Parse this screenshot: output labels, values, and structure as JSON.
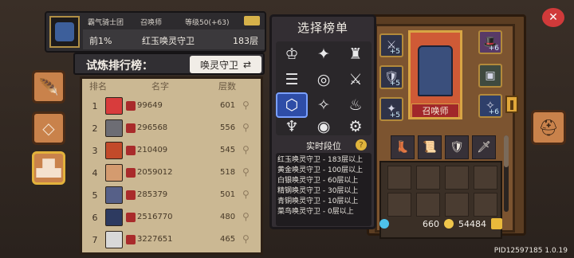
{
  "header": {
    "guild": "霸气骑士团",
    "class_name": "召唤师",
    "level": "等级50(+63)",
    "percent": "前1%",
    "rank_title": "红玉唤灵守卫",
    "floors": "183层"
  },
  "ranking": {
    "title": "试炼排行榜：",
    "dropdown_label": "唤灵守卫",
    "dropdown_icon": "swap-icon",
    "columns": [
      "排名",
      "名字",
      "层数"
    ],
    "rows": [
      {
        "rank": "1",
        "name": "99649",
        "floors": "601",
        "avatar_color": "#d83c3c"
      },
      {
        "rank": "2",
        "name": "296568",
        "floors": "556",
        "avatar_color": "#6d6d74"
      },
      {
        "rank": "3",
        "name": "210409",
        "floors": "545",
        "avatar_color": "#c24a2a"
      },
      {
        "rank": "4",
        "name": "2059012",
        "floors": "518",
        "avatar_color": "#d49b6f"
      },
      {
        "rank": "5",
        "name": "285379",
        "floors": "501",
        "avatar_color": "#566088"
      },
      {
        "rank": "6",
        "name": "2516770",
        "floors": "480",
        "avatar_color": "#2d3a60"
      },
      {
        "rank": "7",
        "name": "3227651",
        "floors": "465",
        "avatar_color": "#d8d8d8"
      }
    ]
  },
  "selection": {
    "title": "选择榜单",
    "icons": [
      "crest-icon",
      "star-blade-icon",
      "castle-icon",
      "pillar-icon",
      "swirl-icon",
      "crossed-axes-icon",
      "hex-emblem-icon",
      "compass-star-icon",
      "flame-icon",
      "horns-icon",
      "vortex-icon",
      "gear-icon"
    ],
    "selected_index": 6
  },
  "realtime": {
    "title": "实时段位",
    "coin_icon": "?",
    "tiers": [
      "红玉唤灵守卫 - 183层以上",
      "黄金唤灵守卫 - 100层以上",
      "白银唤灵守卫 - 60层以上",
      "精钢唤灵守卫 - 30层以上",
      "青铜唤灵守卫 - 10层以上",
      "菜鸟唤灵守卫 - 0层以上"
    ]
  },
  "hero": {
    "label": "召唤师",
    "slots_plus": [
      "+5",
      "+6",
      "+5",
      "+5",
      "+6"
    ]
  },
  "resources": {
    "gems": "660",
    "coins": "54484"
  },
  "pid": "PID12597185 1.0.19"
}
